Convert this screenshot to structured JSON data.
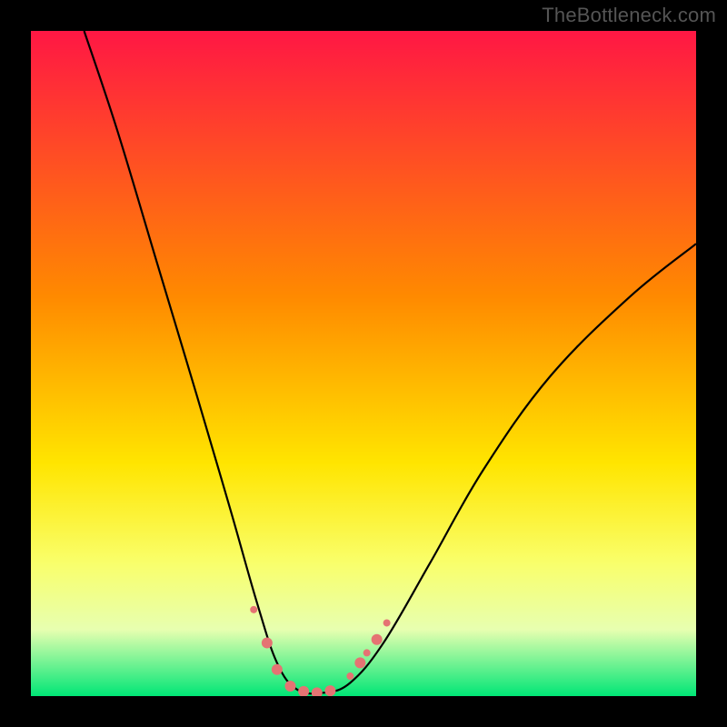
{
  "watermark": "TheBottleneck.com",
  "chart_data": {
    "type": "line",
    "title": "",
    "xlabel": "",
    "ylabel": "",
    "xlim": [
      0,
      100
    ],
    "ylim": [
      0,
      100
    ],
    "gradient_stops": [
      {
        "offset": 0,
        "color": "#ff1744"
      },
      {
        "offset": 40,
        "color": "#ff8a00"
      },
      {
        "offset": 65,
        "color": "#ffe500"
      },
      {
        "offset": 80,
        "color": "#f9ff6b"
      },
      {
        "offset": 90,
        "color": "#e7ffb0"
      },
      {
        "offset": 100,
        "color": "#00e676"
      }
    ],
    "main_curve": [
      {
        "x": 8,
        "y": 100
      },
      {
        "x": 13,
        "y": 85
      },
      {
        "x": 19,
        "y": 65
      },
      {
        "x": 25,
        "y": 45
      },
      {
        "x": 30,
        "y": 28
      },
      {
        "x": 34,
        "y": 14
      },
      {
        "x": 37,
        "y": 5
      },
      {
        "x": 40,
        "y": 1
      },
      {
        "x": 44,
        "y": 0.5
      },
      {
        "x": 48,
        "y": 2
      },
      {
        "x": 53,
        "y": 8
      },
      {
        "x": 60,
        "y": 20
      },
      {
        "x": 68,
        "y": 34
      },
      {
        "x": 78,
        "y": 48
      },
      {
        "x": 90,
        "y": 60
      },
      {
        "x": 100,
        "y": 68
      }
    ],
    "markers": [
      {
        "x": 33.5,
        "y": 13,
        "r": 4
      },
      {
        "x": 35.5,
        "y": 8,
        "r": 6
      },
      {
        "x": 37,
        "y": 4,
        "r": 6
      },
      {
        "x": 39,
        "y": 1.5,
        "r": 6
      },
      {
        "x": 41,
        "y": 0.7,
        "r": 6
      },
      {
        "x": 43,
        "y": 0.5,
        "r": 6
      },
      {
        "x": 45,
        "y": 0.8,
        "r": 6
      },
      {
        "x": 48,
        "y": 3,
        "r": 4
      },
      {
        "x": 49.5,
        "y": 5,
        "r": 6
      },
      {
        "x": 50.5,
        "y": 6.5,
        "r": 4
      },
      {
        "x": 52,
        "y": 8.5,
        "r": 6
      },
      {
        "x": 53.5,
        "y": 11,
        "r": 4
      }
    ],
    "marker_color": "#e57373",
    "curve_color": "#000000"
  }
}
